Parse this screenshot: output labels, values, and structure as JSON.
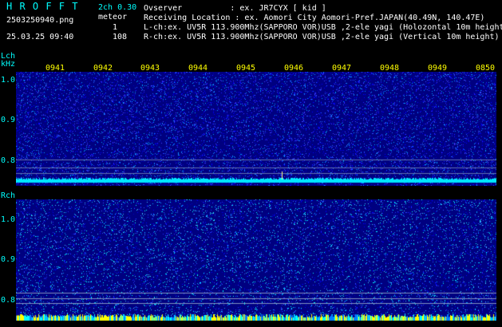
{
  "header": {
    "brand": "H R O F F T",
    "mode": "2ch 0.30",
    "filename": "2503250940.png",
    "meteor_label": "meteor",
    "meteor_lch": "1",
    "datetime": "25.03.25 09:40",
    "meteor_rch": "108",
    "observer_line": "Ovserver          : ex. JR7CYX [ kid ]",
    "location_line": "Receiving Location : ex. Aomori City Aomori-Pref.JAPAN(40.49N, 140.47E)",
    "lch_line": "L-ch:ex. UV5R 113.900Mhz(SAPPORO VOR)USB ,2-ele yagi (Holozontal 10m height)",
    "rch_line": "R-ch:ex. UV5R 113.900Mhz(SAPPORO VOR)USB ,2-ele yagi (Vertical 10m height)"
  },
  "lch": {
    "label": "Lch",
    "unit": "kHz",
    "y_ticks": [
      "1.0",
      "0.9",
      "0.8"
    ],
    "time_ticks": [
      "0941",
      "0942",
      "0943",
      "0944",
      "0945",
      "0946",
      "0947",
      "0948",
      "0949",
      "0850"
    ]
  },
  "rch": {
    "label": "Rch",
    "y_ticks": [
      "1.0",
      "0.9",
      "0.8"
    ]
  },
  "colors": {
    "background": "#000000",
    "label_cyan": "#00ffff",
    "text_white": "#ffffff",
    "tick_yellow": "#ffff00",
    "noise_floor": "#000080",
    "signal_trace": "#00e8ff"
  }
}
